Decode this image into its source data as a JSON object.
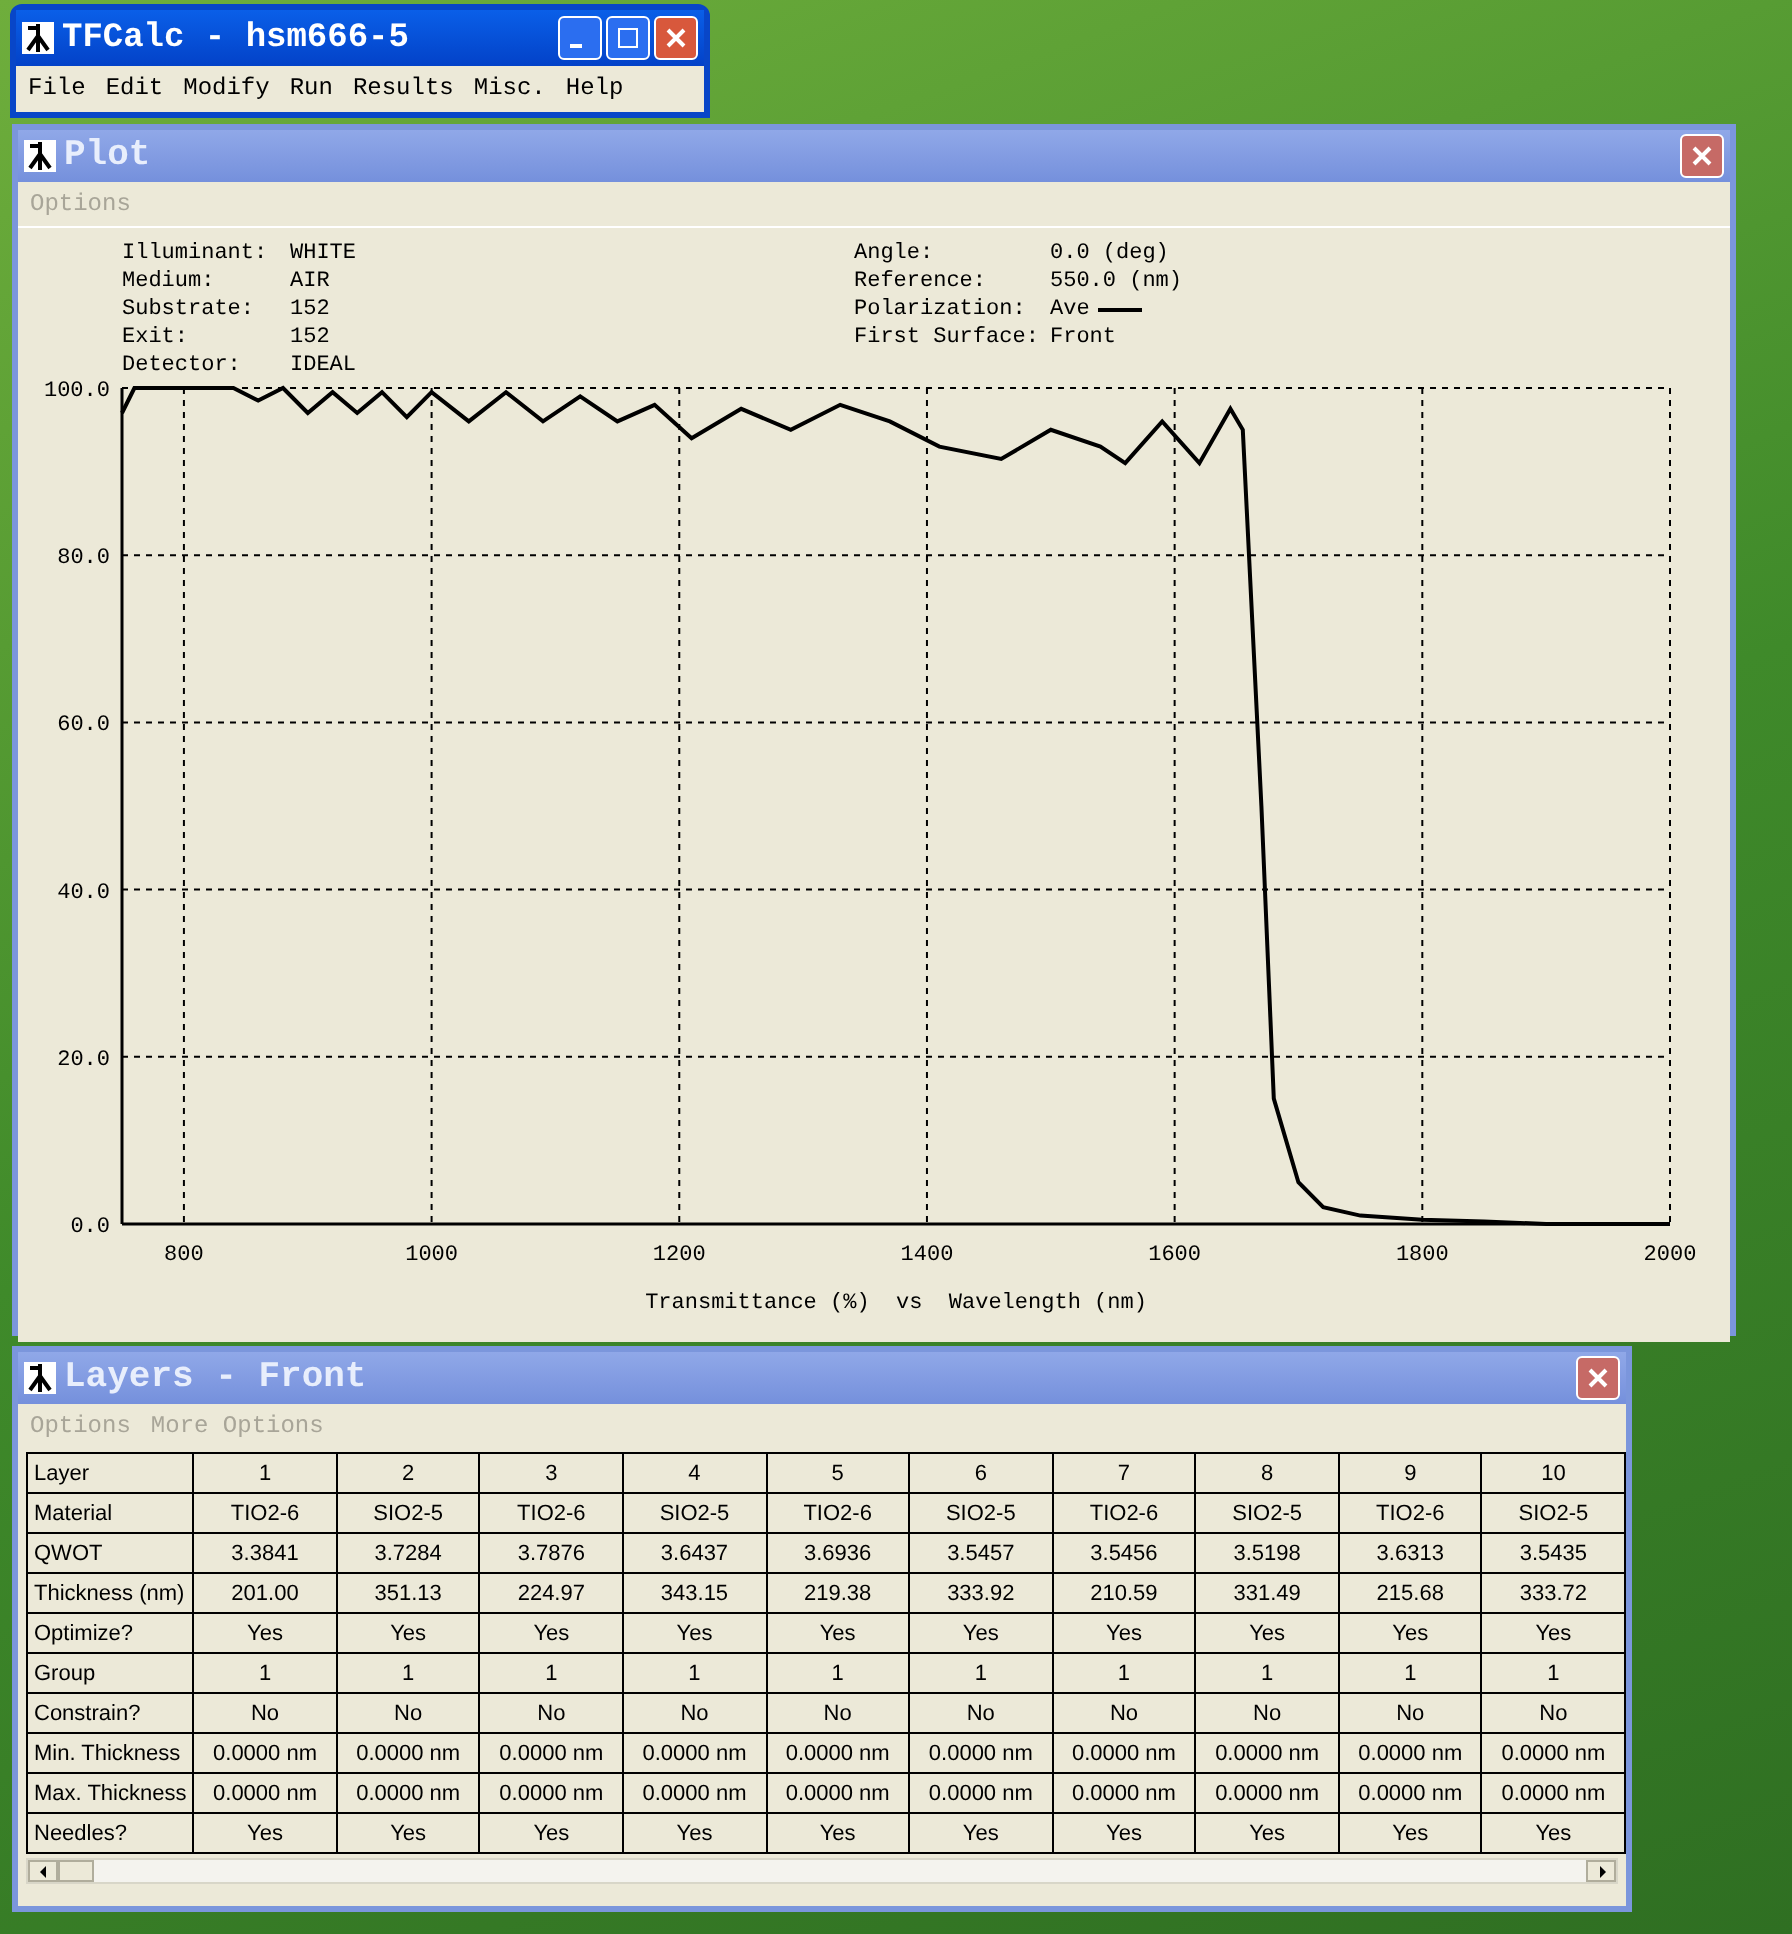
{
  "main_window": {
    "title": "TFCalc - hsm666-5",
    "menu": [
      {
        "label": "File",
        "disabled": false
      },
      {
        "label": "Edit",
        "disabled": false
      },
      {
        "label": "Modify",
        "disabled": false
      },
      {
        "label": "Run",
        "disabled": false
      },
      {
        "label": "Results",
        "disabled": false
      },
      {
        "label": "Misc.",
        "disabled": false
      },
      {
        "label": "Help",
        "disabled": false
      }
    ]
  },
  "plot_window": {
    "title": "Plot",
    "menu": [
      {
        "label": "Options",
        "disabled": true
      }
    ],
    "info_left": [
      {
        "label": "Illuminant:",
        "value": "WHITE"
      },
      {
        "label": "Medium:",
        "value": "AIR"
      },
      {
        "label": "Substrate:",
        "value": "152"
      },
      {
        "label": "Exit:",
        "value": "152"
      },
      {
        "label": "Detector:",
        "value": "IDEAL"
      }
    ],
    "info_right": [
      {
        "label": "Angle:",
        "value": "0.0 (deg)",
        "kind": "text"
      },
      {
        "label": "Reference:",
        "value": "550.0 (nm)",
        "kind": "text"
      },
      {
        "label": "Polarization:",
        "kind": "legend"
      },
      {
        "label": "First Surface:",
        "value": "Front",
        "kind": "text"
      }
    ],
    "chart_data": {
      "type": "line",
      "grid": true,
      "xlabel": "Transmittance (%)  vs  Wavelength (nm)",
      "xlim": [
        750,
        2000
      ],
      "ylim": [
        0,
        100
      ],
      "xticks": [
        800,
        1000,
        1200,
        1400,
        1600,
        1800,
        2000
      ],
      "yticks": [
        {
          "value": 0,
          "label": "0.0"
        },
        {
          "value": 20,
          "label": "20.0"
        },
        {
          "value": 40,
          "label": "40.0"
        },
        {
          "value": 60,
          "label": "60.0"
        },
        {
          "value": 80,
          "label": "80.0"
        },
        {
          "value": 100,
          "label": "100.0"
        }
      ],
      "x": [
        750,
        760,
        800,
        840,
        860,
        880,
        900,
        920,
        940,
        960,
        980,
        1000,
        1030,
        1060,
        1090,
        1120,
        1150,
        1180,
        1210,
        1250,
        1290,
        1330,
        1370,
        1410,
        1460,
        1500,
        1540,
        1560,
        1590,
        1620,
        1645,
        1655,
        1670,
        1680,
        1700,
        1720,
        1750,
        1800,
        1850,
        1900,
        2000
      ],
      "series": [
        {
          "name": "Ave",
          "color": "#000000",
          "values": [
            97,
            100,
            100,
            100,
            98.5,
            100,
            97,
            99.5,
            97,
            99.5,
            96.5,
            99.5,
            96,
            99.5,
            96,
            99,
            96,
            98,
            94,
            97.5,
            95,
            98,
            96,
            93,
            91.5,
            95,
            93,
            91,
            96,
            91,
            97.5,
            95,
            50,
            15,
            5,
            2,
            1,
            0.5,
            0.3,
            0,
            0
          ]
        }
      ]
    }
  },
  "layers_window": {
    "title": "Layers - Front",
    "menu": [
      {
        "label": "Options",
        "disabled": true
      },
      {
        "label": "More Options",
        "disabled": true
      }
    ],
    "rows": [
      {
        "label": "Layer",
        "cells": [
          "1",
          "2",
          "3",
          "4",
          "5",
          "6",
          "7",
          "8",
          "9",
          "10"
        ]
      },
      {
        "label": "Material",
        "cells": [
          "TIO2-6",
          "SIO2-5",
          "TIO2-6",
          "SIO2-5",
          "TIO2-6",
          "SIO2-5",
          "TIO2-6",
          "SIO2-5",
          "TIO2-6",
          "SIO2-5"
        ]
      },
      {
        "label": "QWOT",
        "cells": [
          "3.3841",
          "3.7284",
          "3.7876",
          "3.6437",
          "3.6936",
          "3.5457",
          "3.5456",
          "3.5198",
          "3.6313",
          "3.5435"
        ]
      },
      {
        "label": "Thickness (nm)",
        "cells": [
          "201.00",
          "351.13",
          "224.97",
          "343.15",
          "219.38",
          "333.92",
          "210.59",
          "331.49",
          "215.68",
          "333.72"
        ]
      },
      {
        "label": "Optimize?",
        "cells": [
          "Yes",
          "Yes",
          "Yes",
          "Yes",
          "Yes",
          "Yes",
          "Yes",
          "Yes",
          "Yes",
          "Yes"
        ]
      },
      {
        "label": "Group",
        "cells": [
          "1",
          "1",
          "1",
          "1",
          "1",
          "1",
          "1",
          "1",
          "1",
          "1"
        ]
      },
      {
        "label": "Constrain?",
        "cells": [
          "No",
          "No",
          "No",
          "No",
          "No",
          "No",
          "No",
          "No",
          "No",
          "No"
        ]
      },
      {
        "label": "Min. Thickness",
        "cells": [
          "0.0000 nm",
          "0.0000 nm",
          "0.0000 nm",
          "0.0000 nm",
          "0.0000 nm",
          "0.0000 nm",
          "0.0000 nm",
          "0.0000 nm",
          "0.0000 nm",
          "0.0000 nm"
        ]
      },
      {
        "label": "Max. Thickness",
        "cells": [
          "0.0000 nm",
          "0.0000 nm",
          "0.0000 nm",
          "0.0000 nm",
          "0.0000 nm",
          "0.0000 nm",
          "0.0000 nm",
          "0.0000 nm",
          "0.0000 nm",
          "0.0000 nm"
        ]
      },
      {
        "label": "Needles?",
        "cells": [
          "Yes",
          "Yes",
          "Yes",
          "Yes",
          "Yes",
          "Yes",
          "Yes",
          "Yes",
          "Yes",
          "Yes"
        ]
      }
    ]
  }
}
